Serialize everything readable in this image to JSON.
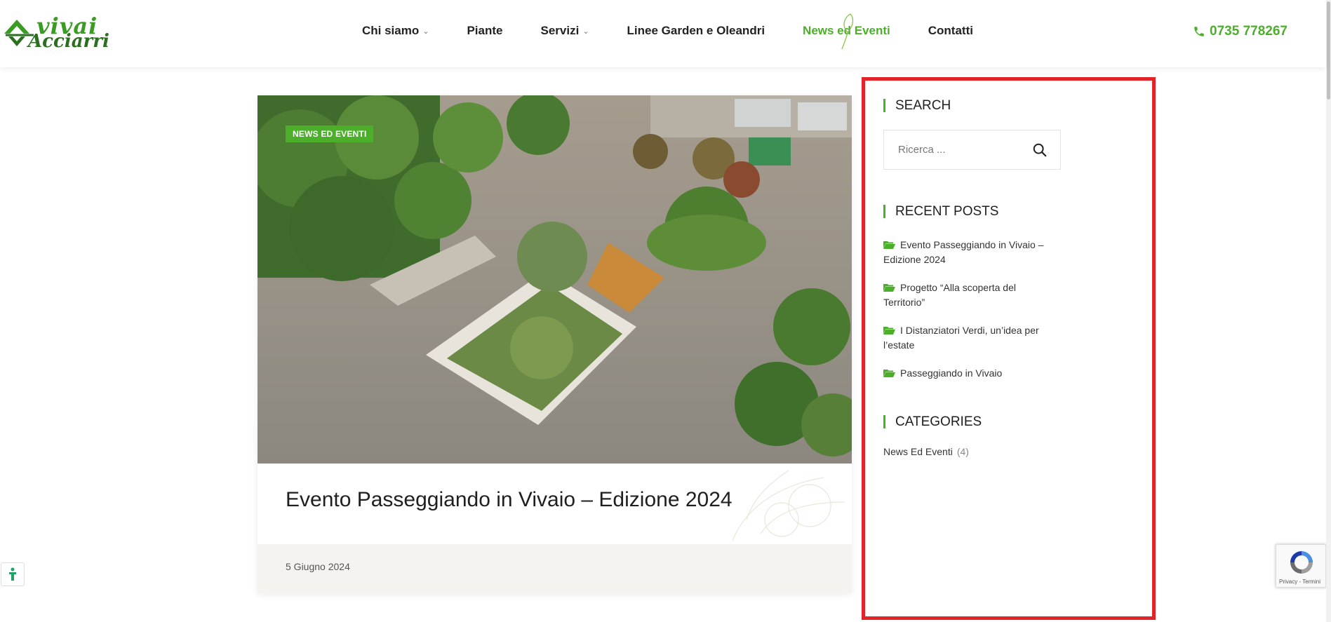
{
  "header": {
    "logo_line1": "vivai",
    "logo_line2": "Acciarri",
    "nav": [
      {
        "label": "Chi siamo",
        "has_dropdown": true
      },
      {
        "label": "Piante",
        "has_dropdown": false
      },
      {
        "label": "Servizi",
        "has_dropdown": true
      },
      {
        "label": "Linee Garden e Oleandri",
        "has_dropdown": false
      },
      {
        "label": "News ed Eventi",
        "has_dropdown": false,
        "active": true
      },
      {
        "label": "Contatti",
        "has_dropdown": false
      }
    ],
    "phone": "0735 778267",
    "phone_icon": "phone-icon"
  },
  "post": {
    "category_badge": "NEWS ED EVENTI",
    "title": "Evento Passeggiando in Vivaio – Edizione 2024",
    "date": "5 Giugno 2024"
  },
  "sidebar": {
    "search": {
      "title": "SEARCH",
      "placeholder": "Ricerca ...",
      "button_icon": "search-icon"
    },
    "recent_posts": {
      "title": "RECENT POSTS",
      "items": [
        "Evento Passeggiando in Vivaio – Edizione 2024",
        "Progetto “Alla scoperta del Territorio”",
        "I Distanziatori Verdi, un’idea per l’estate",
        "Passeggiando in Vivaio"
      ]
    },
    "categories": {
      "title": "CATEGORIES",
      "items": [
        {
          "label": "News Ed Eventi",
          "count": "(4)"
        }
      ]
    }
  },
  "recaptcha": {
    "text": "Privacy - Termini"
  },
  "colors": {
    "accent": "#4caf2a",
    "highlight_border": "#e0242a",
    "meta_bg": "#f5f3ef"
  }
}
